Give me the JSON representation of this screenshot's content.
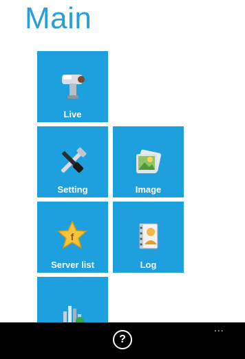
{
  "page": {
    "title": "Main"
  },
  "tiles": [
    {
      "label": "Live",
      "icon": "camera-icon"
    },
    {
      "label": "Setting",
      "icon": "tools-icon"
    },
    {
      "label": "Image",
      "icon": "image-icon"
    },
    {
      "label": "Server list",
      "icon": "server-list-icon"
    },
    {
      "label": "Log",
      "icon": "log-icon"
    },
    {
      "label": "",
      "icon": "stats-icon"
    }
  ],
  "appbar": {
    "help_label": "?",
    "more_label": "..."
  },
  "colors": {
    "title": "#2a9fd8",
    "tile": "#1ea0de",
    "appbar": "#000000"
  }
}
